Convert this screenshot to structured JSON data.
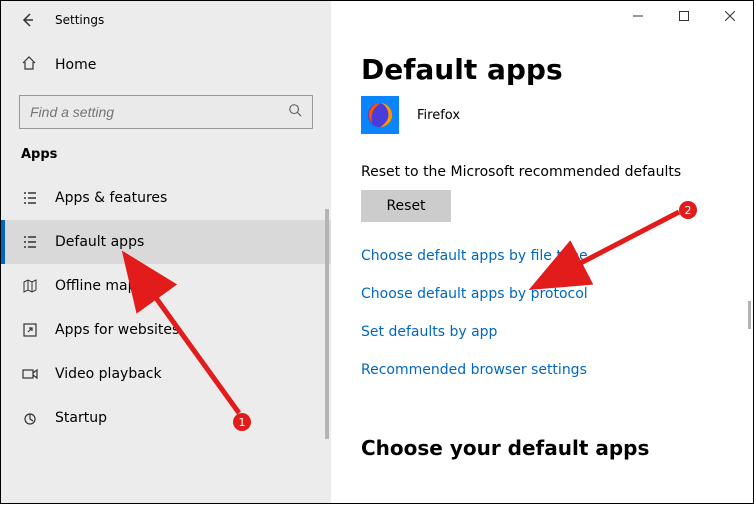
{
  "window": {
    "title": "Settings"
  },
  "sidebar": {
    "home_label": "Home",
    "search_placeholder": "Find a setting",
    "section_heading": "Apps",
    "items": [
      {
        "label": "Apps & features"
      },
      {
        "label": "Default apps"
      },
      {
        "label": "Offline maps"
      },
      {
        "label": "Apps for websites"
      },
      {
        "label": "Video playback"
      },
      {
        "label": "Startup"
      }
    ]
  },
  "main": {
    "page_title": "Default apps",
    "current_app": "Firefox",
    "reset_caption": "Reset to the Microsoft recommended defaults",
    "reset_button": "Reset",
    "links": [
      "Choose default apps by file type",
      "Choose default apps by protocol",
      "Set defaults by app",
      "Recommended browser settings"
    ],
    "subheading": "Choose your default apps"
  },
  "annotations": {
    "badge1": "1",
    "badge2": "2"
  }
}
